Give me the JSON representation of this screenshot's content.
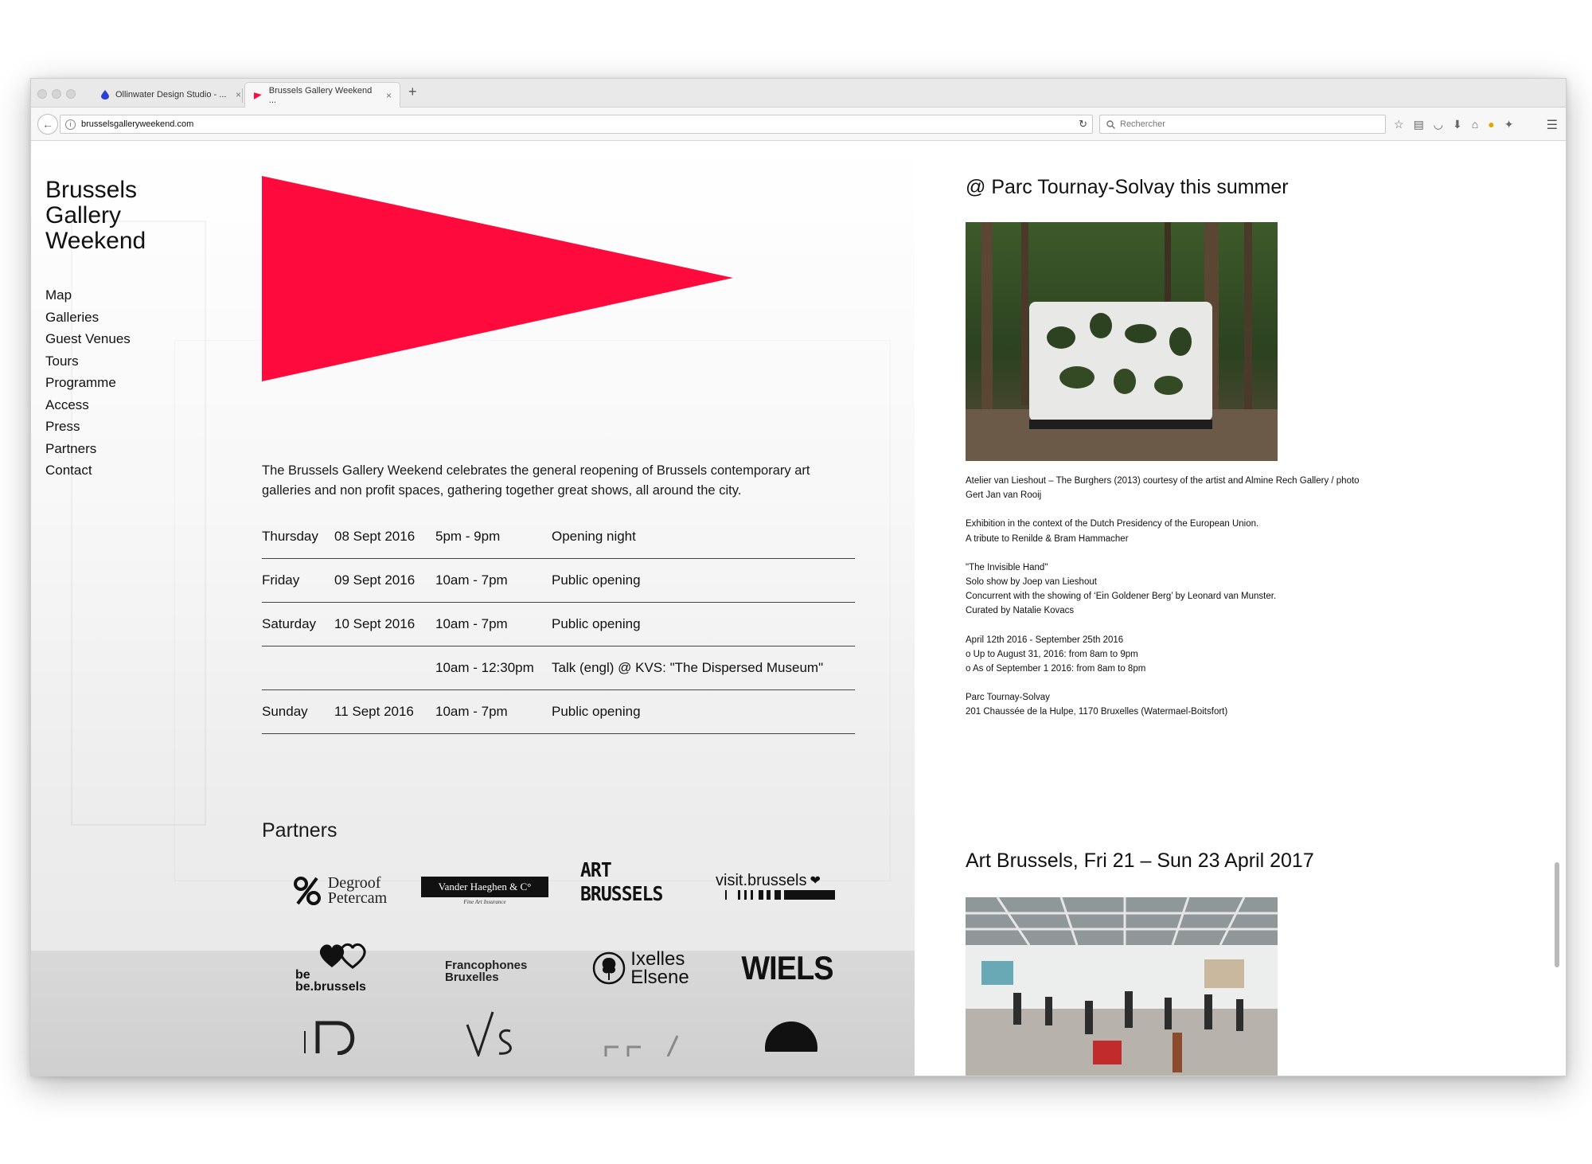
{
  "browser": {
    "tabs": [
      {
        "title": "Ollinwater Design Studio - ...",
        "active": false
      },
      {
        "title": "Brussels Gallery Weekend ...",
        "active": true
      }
    ],
    "new_tab_symbol": "+",
    "close_symbol": "×",
    "url": "brusselsgalleryweekend.com",
    "search_placeholder": "Rechercher",
    "toolbar_icons": [
      "star-icon",
      "clipboard-icon",
      "pocket-icon",
      "download-icon",
      "home-icon",
      "chrome-icon",
      "extension-icon"
    ]
  },
  "site": {
    "title_lines": [
      "Brussels",
      "Gallery",
      "Weekend"
    ],
    "accent_color": "#ff0a3c",
    "nav": [
      "Map",
      "Galleries",
      "Guest Venues",
      "Tours",
      "Programme",
      "Access",
      "Press",
      "Partners",
      "Contact"
    ],
    "intro": "The Brussels Gallery Weekend celebrates the general reopening of Brussels contemporary art galleries and non profit spaces, gathering together great shows, all around the city.",
    "schedule": [
      {
        "day": "Thursday",
        "date": "08 Sept 2016",
        "time": "5pm - 9pm",
        "event": "Opening night"
      },
      {
        "day": "Friday",
        "date": "09 Sept 2016",
        "time": "10am - 7pm",
        "event": "Public opening"
      },
      {
        "day": "Saturday",
        "date": "10 Sept 2016",
        "time": "10am - 7pm",
        "event": "Public opening"
      },
      {
        "day": "",
        "date": "",
        "time": "10am - 12:30pm",
        "event": "Talk (engl) @ KVS: \"The Dispersed Museum\""
      },
      {
        "day": "Sunday",
        "date": "11 Sept 2016",
        "time": "10am - 7pm",
        "event": "Public opening"
      }
    ],
    "partners_title": "Partners",
    "partners": {
      "degroof_1": "Degroof",
      "degroof_2": "Petercam",
      "vanderhaeghen": "Vander Haeghen & C°",
      "vanderhaeghen_sub": "Fine Art Insurance",
      "artbrussels_1": "ART",
      "artbrussels_2": "BRUSSELS",
      "visit": "visit.brussels",
      "bebrussels_1": "be",
      "bebrussels_2": "be.brussels",
      "francophones_1": "Francophones",
      "francophones_2": "Bruxelles",
      "ixelles_1": "Ixelles",
      "ixelles_2": "Elsene",
      "wiels": "WIELS"
    }
  },
  "sidebar_right": {
    "section1": {
      "heading": "@ Parc Tournay-Solvay this summer",
      "caption_1": "Atelier van Lieshout – The Burghers (2013) courtesy of the artist and Almine Rech Gallery / photo",
      "caption_2": "Gert Jan van Rooij",
      "context_1": "Exhibition in the context of the Dutch Presidency of the European Union.",
      "context_2": "A tribute to Renilde & Bram Hammacher",
      "show_1": "\"The Invisible Hand\"",
      "show_2": "Solo show by Joep van Lieshout",
      "show_3": "Concurrent with the showing of ‘Ein Goldener Berg’ by Leonard van Munster.",
      "show_4": "Curated by Natalie Kovacs",
      "dates_1": "April 12th 2016 - September 25th 2016",
      "dates_2": "o Up to August 31, 2016: from 8am to 9pm",
      "dates_3": "o As of September 1 2016: from 8am to 8pm",
      "venue_1": "Parc Tournay-Solvay",
      "venue_2": "201 Chaussée de la Hulpe, 1170 Bruxelles (Watermael-Boitsfort)"
    },
    "section2": {
      "heading": "Art Brussels, Fri 21 – Sun 23 April 2017"
    }
  }
}
